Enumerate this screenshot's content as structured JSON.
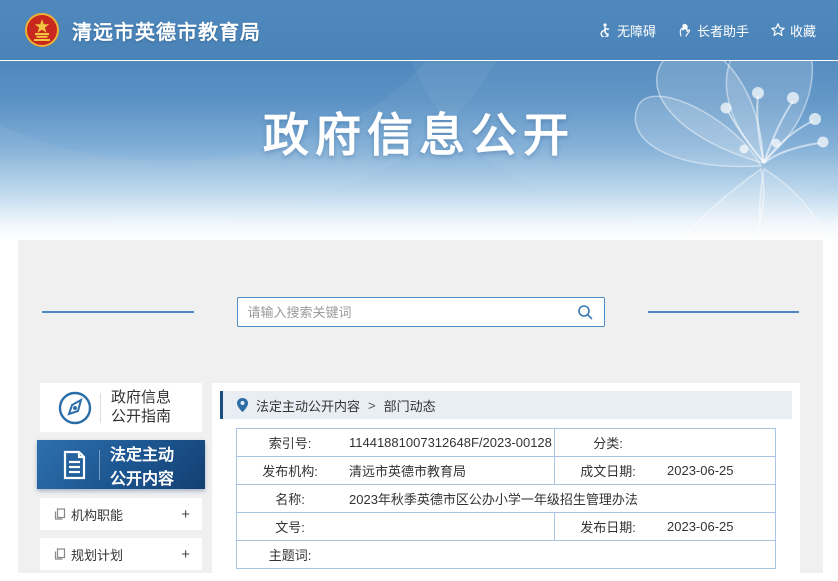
{
  "header": {
    "site_title": "清远市英德市教育局",
    "links": [
      {
        "icon": "accessibility-icon",
        "label": "无障碍"
      },
      {
        "icon": "elder-assist-icon",
        "label": "长者助手"
      },
      {
        "icon": "star-icon",
        "label": "收藏"
      }
    ]
  },
  "banner": {
    "title": "政府信息公开"
  },
  "search": {
    "placeholder": "请输入搜索关键词"
  },
  "sidebar": {
    "guide": {
      "line1": "政府信息",
      "line2": "公开指南"
    },
    "active": {
      "line1": "法定主动",
      "line2": "公开内容"
    },
    "items": [
      {
        "label": "机构职能",
        "expand": "+"
      },
      {
        "label": "规划计划",
        "expand": "+"
      }
    ]
  },
  "breadcrumb": {
    "root": "法定主动公开内容",
    "separator": ">",
    "current": "部门动态"
  },
  "table": {
    "rows": [
      {
        "cells": [
          {
            "label": "索引号:",
            "value": "11441881007312648F/2023-00128"
          },
          {
            "label": "分类:",
            "value": ""
          }
        ]
      },
      {
        "cells": [
          {
            "label": "发布机构:",
            "value": "清远市英德市教育局"
          },
          {
            "label": "成文日期:",
            "value": "2023-06-25"
          }
        ]
      },
      {
        "cells": [
          {
            "label": "名称:",
            "value": "2023年秋季英德市区公办小学一年级招生管理办法"
          }
        ]
      },
      {
        "cells": [
          {
            "label": "文号:",
            "value": ""
          },
          {
            "label": "发布日期:",
            "value": "2023-06-25"
          }
        ]
      },
      {
        "cells": [
          {
            "label": "主题词:",
            "value": ""
          }
        ]
      }
    ]
  },
  "colors": {
    "header_blue": "#4a83b7",
    "active_nav_blue": "#1c558f",
    "accent_bar_navy": "#1d4d7d",
    "table_border_blue": "#a9c5e2",
    "deco_line_blue": "#4d87c3",
    "breadcrumb_bg": "#e9eef4",
    "platform_bg": "#f0f0f1"
  }
}
